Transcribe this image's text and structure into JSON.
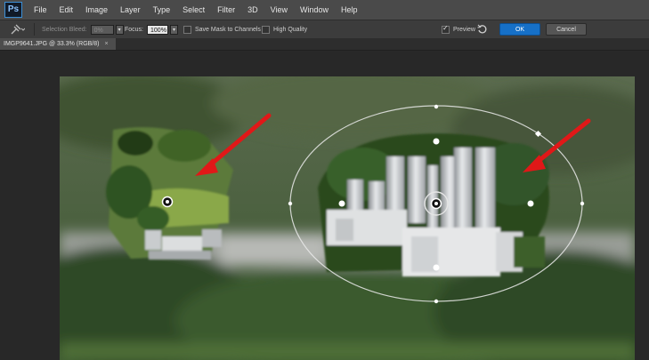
{
  "app": {
    "logo": "Ps"
  },
  "menu": [
    "File",
    "Edit",
    "Image",
    "Layer",
    "Type",
    "Select",
    "Filter",
    "3D",
    "View",
    "Window",
    "Help"
  ],
  "options": {
    "selection_bleed_label": "Selection Bleed:",
    "selection_bleed_value": "0%",
    "focus_label": "Focus:",
    "focus_value": "100%",
    "save_mask_label": "Save Mask to Channels",
    "high_quality_label": "High Quality",
    "preview_label": "Preview",
    "preview_checked": true,
    "ok_label": "OK",
    "cancel_label": "Cancel"
  },
  "document": {
    "tab_title": "IMGP9641.JPG @ 33.3% (RGB/8)",
    "close_glyph": "×"
  },
  "colors": {
    "accent": "#1670c7",
    "annotation_arrow": "#e01818",
    "menubar": "#4a4a4a"
  }
}
